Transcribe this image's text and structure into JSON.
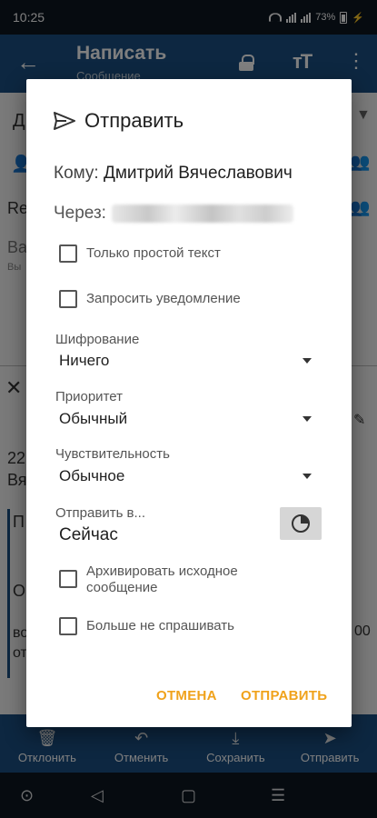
{
  "status_bar": {
    "time": "10:25",
    "battery": "73%"
  },
  "app_bar": {
    "title": "Написать",
    "subtitle": "Сообщение"
  },
  "background": {
    "frag_d": "Д",
    "frag_re": "Re",
    "frag_va": "Ва",
    "frag_vy": "Вы",
    "frag_22": "22",
    "frag_vya": "Вя",
    "frag_p": "П",
    "frag_o": "О",
    "frag_vo": "во",
    "frag_ot": "от",
    "frag_00": "00"
  },
  "action_bar": {
    "items": [
      {
        "label": "Отклонить",
        "icon": "trash-icon"
      },
      {
        "label": "Отменить",
        "icon": "undo-icon"
      },
      {
        "label": "Сохранить",
        "icon": "save-icon"
      },
      {
        "label": "Отправить",
        "icon": "send-icon"
      }
    ]
  },
  "dialog": {
    "title": "Отправить",
    "to_label": "Кому:",
    "to_value": "Дмитрий Вячеславович",
    "via_label": "Через:",
    "checkbox_plain_text": "Только простой текст",
    "checkbox_receipt": "Запросить уведомление",
    "encryption_label": "Шифрование",
    "encryption_value": "Ничего",
    "priority_label": "Приоритет",
    "priority_value": "Обычный",
    "sensitivity_label": "Чувствительность",
    "sensitivity_value": "Обычное",
    "send_in_label": "Отправить в...",
    "send_in_value": "Сейчас",
    "checkbox_archive": "Архивировать исходное сообщение",
    "checkbox_dont_ask": "Больше не спрашивать",
    "cancel_button": "ОТМЕНА",
    "send_button": "ОТПРАВИТЬ"
  },
  "colors": {
    "accent": "#f0a21b",
    "app_bar": "#1b4f82",
    "status_bar": "#0d1621"
  }
}
